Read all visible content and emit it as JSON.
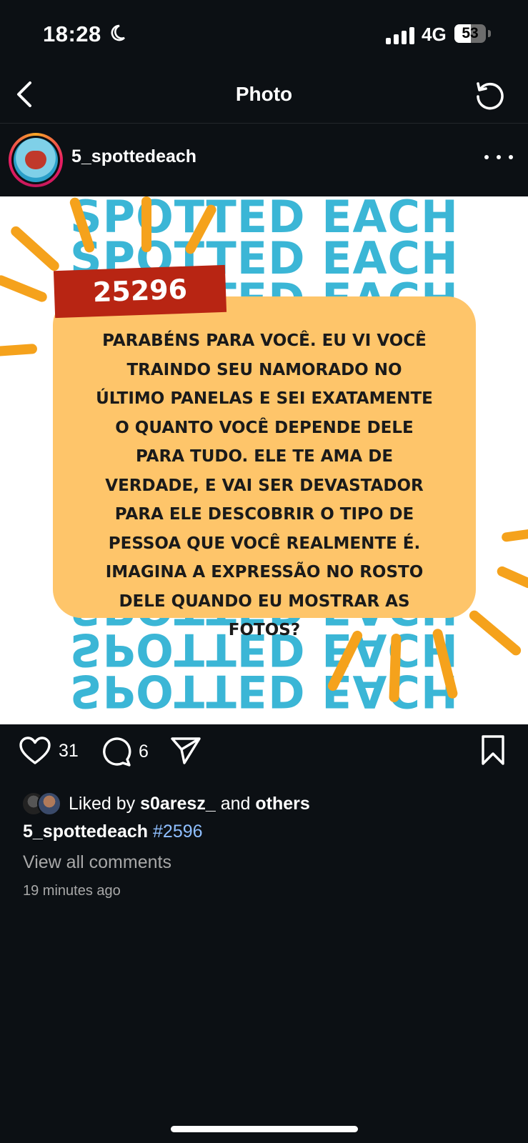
{
  "status": {
    "time": "18:28",
    "network": "4G",
    "battery": "53",
    "battery_level": 53
  },
  "nav": {
    "title": "Photo",
    "back_icon": "chevron-left-icon",
    "refresh_icon": "refresh-icon"
  },
  "post": {
    "username": "5_spottedeach",
    "image": {
      "bg_word": "SPOTTED EACH",
      "badge": "25296",
      "message": "Parabéns para você. Eu vi você traindo seu namorado no último Panelas e sei exatamente o quanto você depende dele para tudo. Ele te ama de verdade, e vai ser devastador para ele descobrir o tipo de pessoa que você realmente é. Imagina a expressão no rosto dele quando eu mostrar as fotos?"
    },
    "likes_count": "31",
    "comments_count": "6",
    "liked_prefix": "Liked by",
    "liked_user": "s0aresz_",
    "liked_and": "and",
    "liked_others": "others",
    "caption_user": "5_spottedeach",
    "caption_hashtag": "#2596",
    "view_all_comments": "View all comments",
    "time_ago": "19 minutes ago"
  },
  "colors": {
    "background": "#0c1014",
    "accent_blue": "#3bb6d6",
    "badge_red": "#b82513",
    "card_yellow": "#fec56a",
    "ray_orange": "#f5a21c",
    "hashtag": "#8fbfff"
  }
}
